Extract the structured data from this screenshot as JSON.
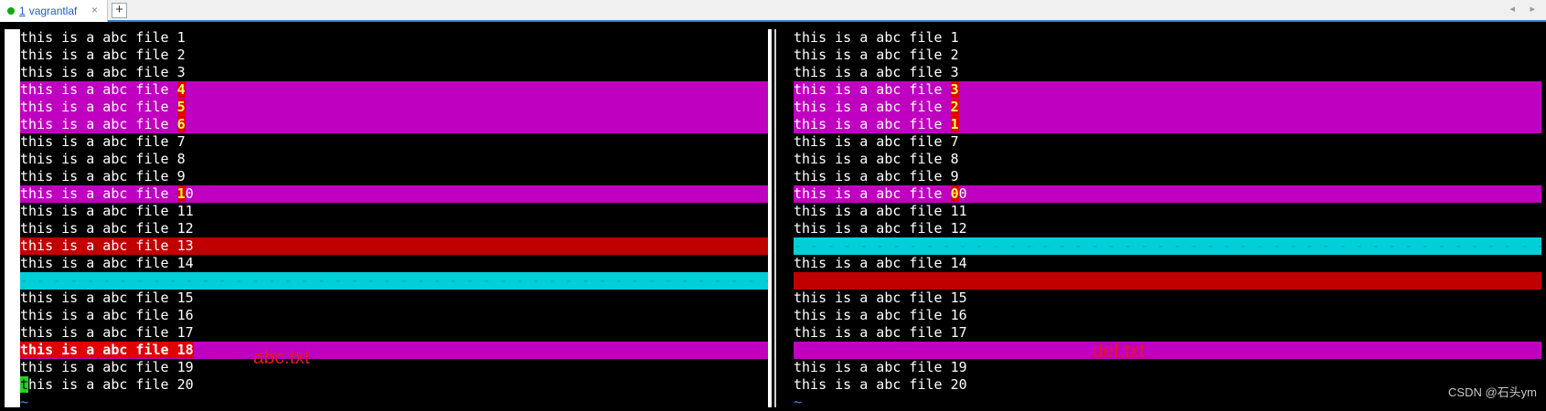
{
  "tabbar": {
    "tab_number": "1",
    "tab_name": "vagrantlaf",
    "close_label": "×",
    "add_label": "+",
    "prev_icon": "◂",
    "next_icon": "▸"
  },
  "left": {
    "lines": [
      {
        "text": "this is a abc file 1"
      },
      {
        "text": "this is a abc file 2"
      },
      {
        "text": "this is a abc file 3"
      },
      {
        "pre": "this is a abc file ",
        "hl": "4",
        "post": ""
      },
      {
        "pre": "this is a abc file ",
        "hl": "5",
        "post": ""
      },
      {
        "pre": "this is a abc file ",
        "hl": "6",
        "post": ""
      },
      {
        "text": "this is a abc file 7"
      },
      {
        "text": "this is a abc file 8"
      },
      {
        "text": "this is a abc file 9"
      },
      {
        "pre": "this is a abc file ",
        "hl": "1",
        "post": "0"
      },
      {
        "text": "this is a abc file 11"
      },
      {
        "text": "this is a abc file 12"
      },
      {
        "text": "this is a abc file 13"
      },
      {
        "text": "this is a abc file 14"
      },
      {
        "filler": "- - - - - - - - - - - - - - - - - - - - - - - - - - - - - - - - - - - - - - - - - - - - - - - - - - - - - - - - - - - - - - - - - - - - - - - - - - - - - - - - - - - - - - - - - -"
      },
      {
        "text": "this is a abc file 15"
      },
      {
        "text": "this is a abc file 16"
      },
      {
        "text": "this is a abc file 17"
      },
      {
        "text": "this is a abc file 18"
      },
      {
        "text": "this is a abc file 19"
      },
      {
        "cursor": "t",
        "post": "his is a abc file 20"
      },
      {
        "tilde": "~"
      }
    ]
  },
  "right": {
    "lines": [
      {
        "text": "this is a abc file 1"
      },
      {
        "text": "this is a abc file 2"
      },
      {
        "text": "this is a abc file 3"
      },
      {
        "pre": "this is a abc file ",
        "hl": "3",
        "post": ""
      },
      {
        "pre": "this is a abc file ",
        "hl": "2",
        "post": ""
      },
      {
        "pre": "this is a abc file ",
        "hl": "1",
        "post": ""
      },
      {
        "text": "this is a abc file 7"
      },
      {
        "text": "this is a abc file 8"
      },
      {
        "text": "this is a abc file 9"
      },
      {
        "pre": "this is a abc file ",
        "hl": "0",
        "post": "0"
      },
      {
        "text": "this is a abc file 11"
      },
      {
        "text": "this is a abc file 12"
      },
      {
        "filler": "- - - - - - - - - - - - - - - - - - - - - - - - - - - - - - - - - - - - - - - - - - - - - - - - - - - - - - - - - - - - - - - - - - - - - - - - - - - - - - - - - - - - - - - - - -"
      },
      {
        "text": "this is a abc file 14"
      },
      {
        "text": ""
      },
      {
        "text": "this is a abc file 15"
      },
      {
        "text": "this is a abc file 16"
      },
      {
        "text": "this is a abc file 17"
      },
      {
        "text": ""
      },
      {
        "text": "this is a abc file 19"
      },
      {
        "text": "this is a abc file 20"
      },
      {
        "tilde": "~"
      }
    ]
  },
  "labels": {
    "left_file": "abc.txt",
    "right_file": "def.txt"
  },
  "watermark": "CSDN @石头ym",
  "colors": {
    "changed_line": "#c000c0",
    "removed_line": "#c00000",
    "filler_line": "#00cfd8",
    "changed_text": "#e00000",
    "tab_accent": "#2f7fd8"
  }
}
